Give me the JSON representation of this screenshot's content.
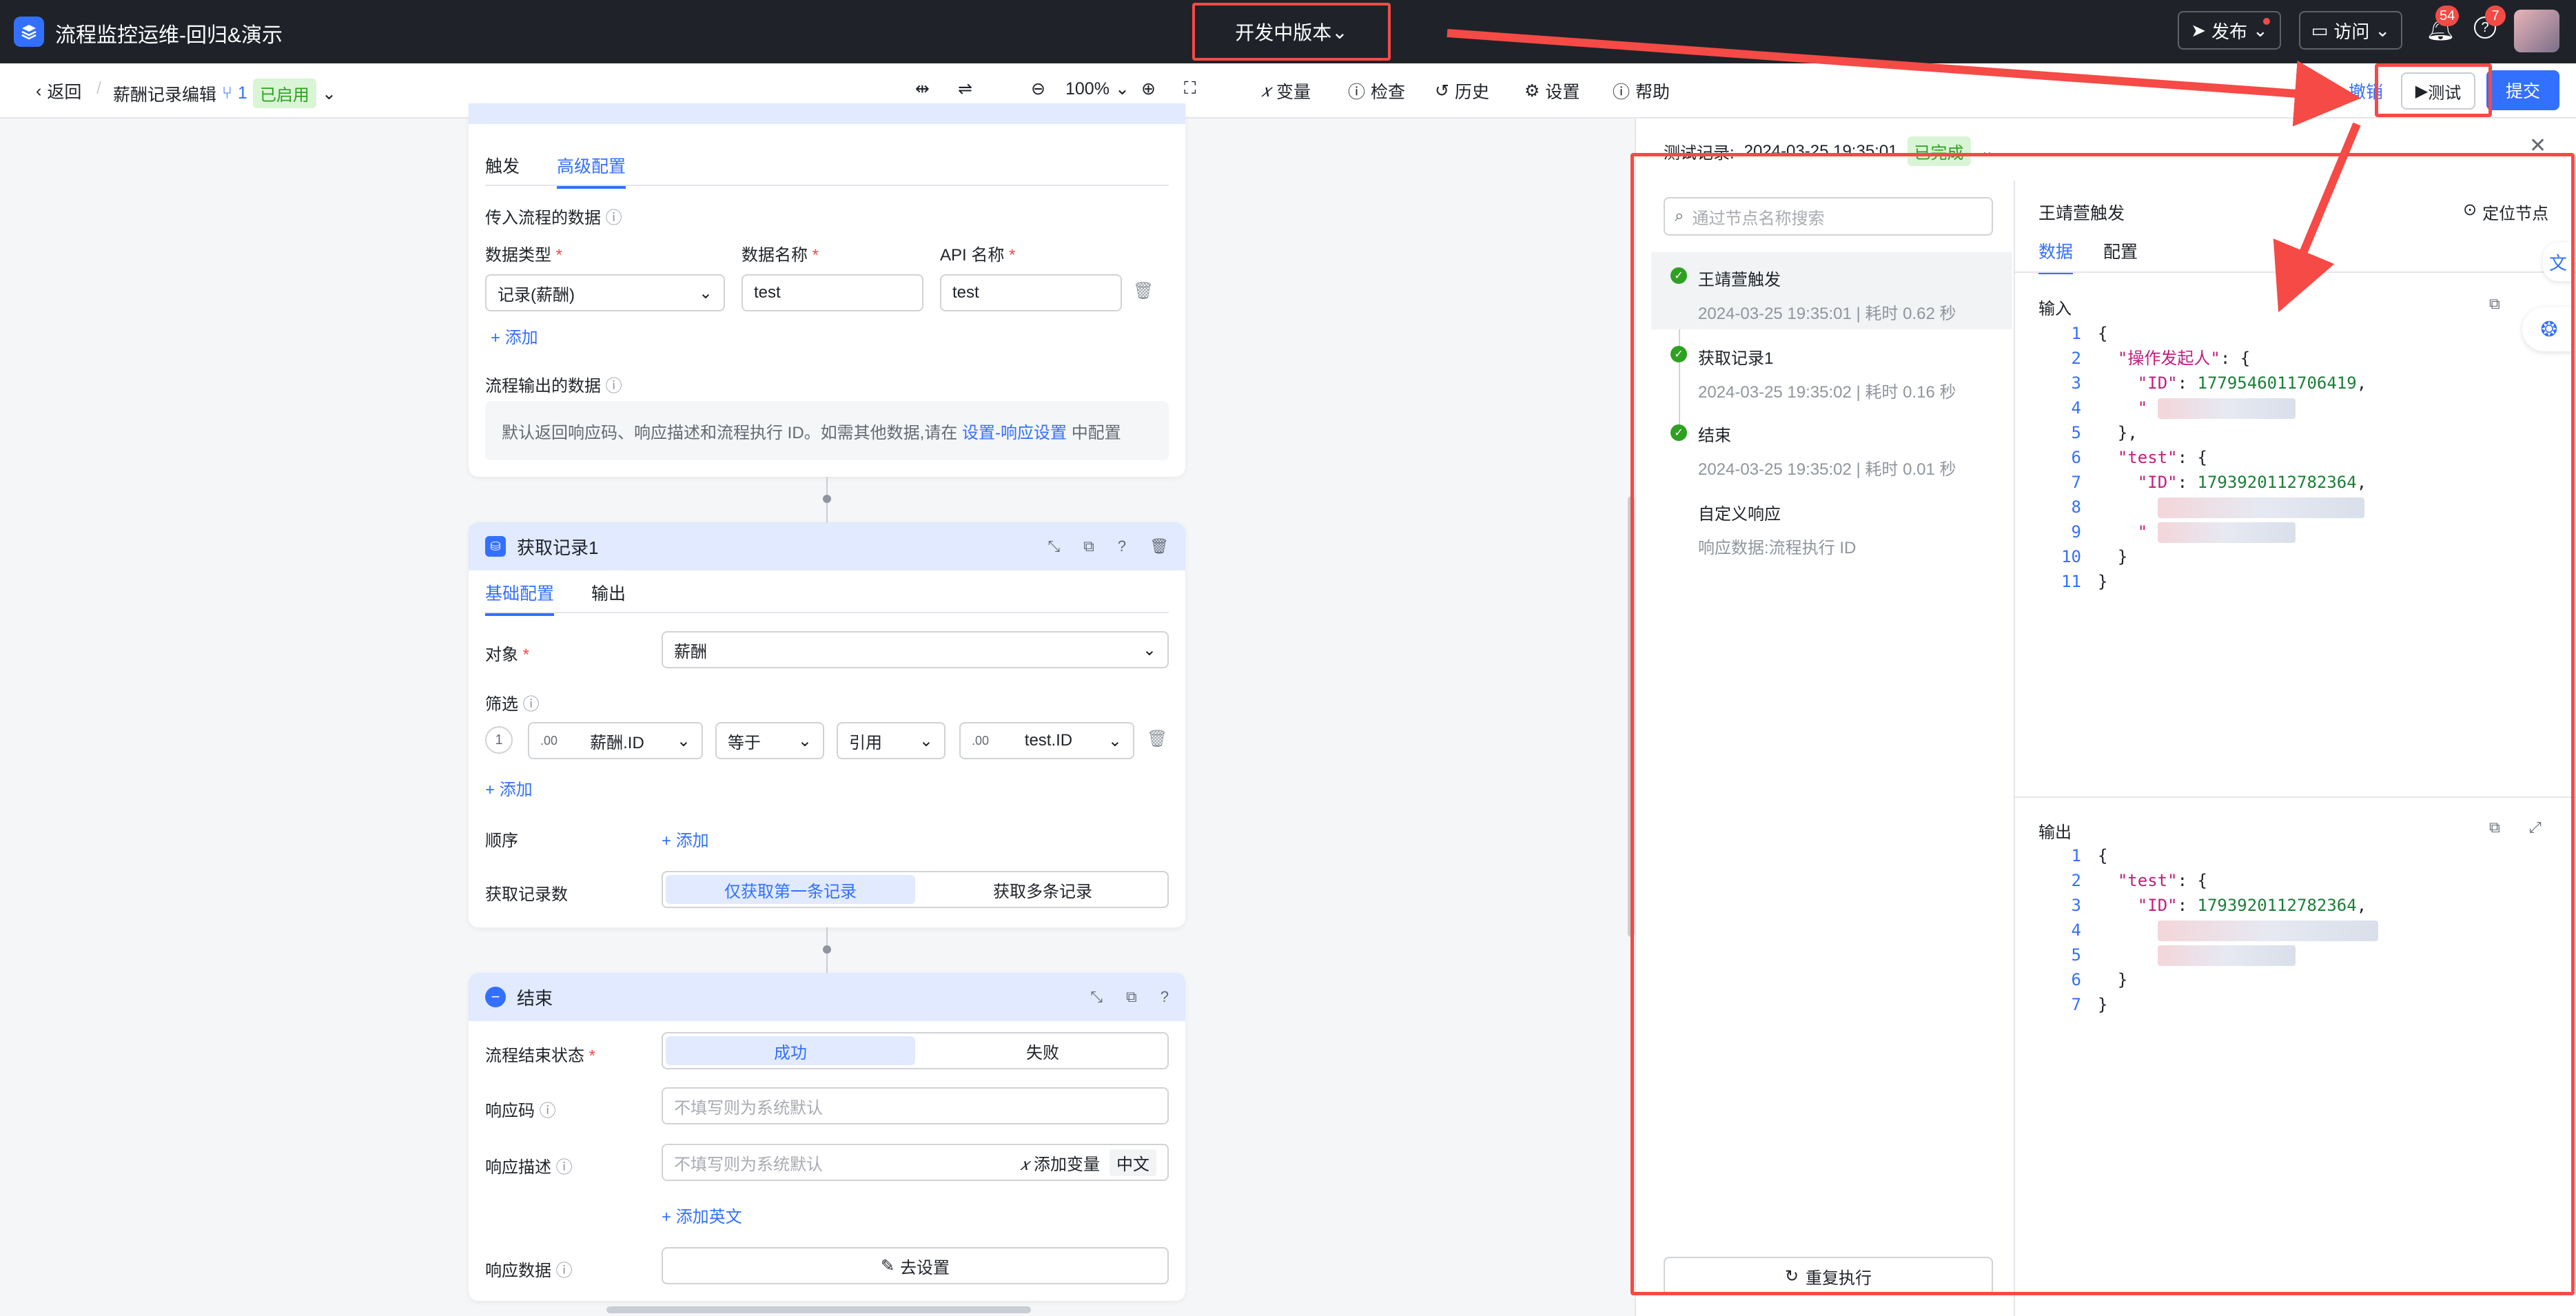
{
  "app": {
    "title": "流程监控运维-回归&演示"
  },
  "version": {
    "label": "开发中版本"
  },
  "topbar": {
    "publish": "发布",
    "visit": "访问",
    "notif_count": "54",
    "help_count": "7"
  },
  "toolbar": {
    "back": "返回",
    "doc_title": "薪酬记录编辑",
    "version_num": "1",
    "status": "已启用",
    "zoom": "100%",
    "variables": "变量",
    "check": "检查",
    "history": "历史",
    "settings": "设置",
    "help": "帮助",
    "submit_hint": "提交",
    "revoke": "撤销",
    "test": "测试",
    "submit": "提交"
  },
  "trigger_card": {
    "tabs": [
      "触发",
      "高级配置"
    ],
    "input_section": "传入流程的数据",
    "col_type": "数据类型",
    "col_name": "数据名称",
    "col_api": "API 名称",
    "type_value": "记录(薪酬)",
    "name_value": "test",
    "api_value": "test",
    "add": "添加",
    "output_section": "流程输出的数据",
    "output_note": "默认返回响应码、响应描述和流程执行 ID。如需其他数据,请在",
    "output_link": "设置-响应设置",
    "output_tail": "中配置"
  },
  "get_card": {
    "title": "获取记录1",
    "tabs": [
      "基础配置",
      "输出"
    ],
    "object_label": "对象",
    "object_value": "薪酬",
    "filter_label": "筛选",
    "filter_index": "1",
    "filter_field": "薪酬.ID",
    "filter_op": "等于",
    "filter_ref": "引用",
    "filter_value": "test.ID",
    "add": "添加",
    "order_label": "顺序",
    "order_add": "添加",
    "count_label": "获取记录数",
    "count_options": [
      "仅获取第一条记录",
      "获取多条记录"
    ]
  },
  "end_card": {
    "title": "结束",
    "status_label": "流程结束状态",
    "status_options": [
      "成功",
      "失败"
    ],
    "code_label": "响应码",
    "code_placeholder": "不填写则为系统默认",
    "desc_label": "响应描述",
    "desc_placeholder": "不填写则为系统默认",
    "add_var": "添加变量",
    "lang": "中文",
    "add_en": "添加英文",
    "data_label": "响应数据",
    "goto_settings": "去设置"
  },
  "test_panel": {
    "record_label": "测试记录:",
    "record_time": "2024-03-25 19:35:01",
    "record_status": "已完成",
    "search_placeholder": "通过节点名称搜索",
    "nodes": [
      {
        "name": "王靖萱触发",
        "meta": "2024-03-25 19:35:01 | 耗时 0.62 秒"
      },
      {
        "name": "获取记录1",
        "meta": "2024-03-25 19:35:02 | 耗时 0.16 秒"
      },
      {
        "name": "结束",
        "meta": "2024-03-25 19:35:02 | 耗时 0.01 秒"
      },
      {
        "name": "自定义响应",
        "meta": "响应数据:流程执行 ID"
      }
    ],
    "rerun": "重复执行",
    "detail_title": "王靖萱触发",
    "locate": "定位节点",
    "detail_tabs": [
      "数据",
      "配置"
    ],
    "input_label": "输入",
    "output_label": "输出",
    "input_code": {
      "key1": "\"操作发起人\"",
      "id1": "1779546011706419",
      "key2": "\"test\"",
      "id2": "1793920112782364"
    },
    "output_code": {
      "key1": "\"test\"",
      "id1": "1793920112782364"
    }
  },
  "colors": {
    "accent": "#3370ff",
    "annotation": "#f54a45",
    "success": "#2ea121"
  }
}
